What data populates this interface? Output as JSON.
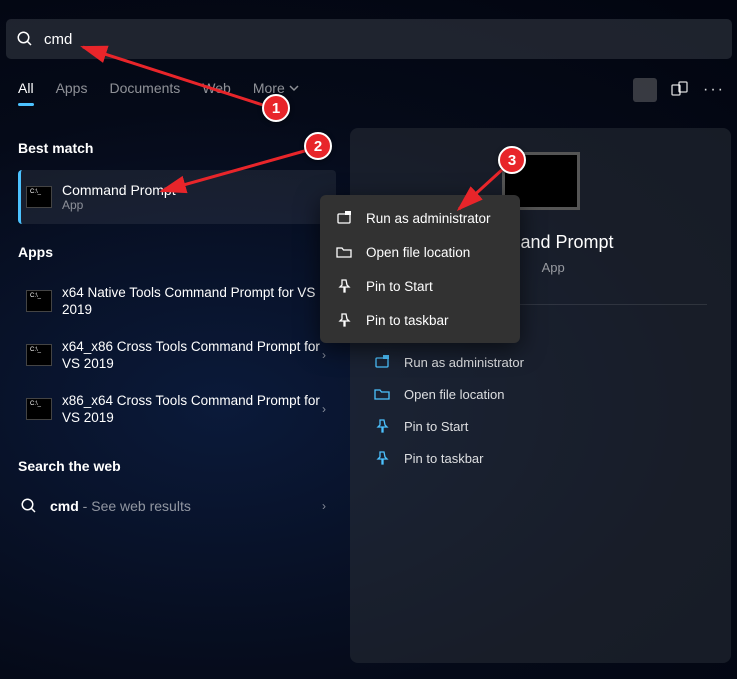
{
  "search": {
    "query": "cmd"
  },
  "tabs": {
    "items": [
      "All",
      "Apps",
      "Documents",
      "Web",
      "More"
    ],
    "active_index": 0
  },
  "sections": {
    "best_match": {
      "header": "Best match",
      "item": {
        "title": "Command Prompt",
        "subtitle": "App",
        "icon_text": "C:\\_"
      }
    },
    "apps": {
      "header": "Apps",
      "items": [
        {
          "title": "x64 Native Tools Command Prompt for VS 2019",
          "icon_text": "C:\\_"
        },
        {
          "title": "x64_x86 Cross Tools Command Prompt for VS 2019",
          "icon_text": "C:\\_"
        },
        {
          "title": "x86_x64 Cross Tools Command Prompt for VS 2019",
          "icon_text": "C:\\_"
        }
      ]
    },
    "web": {
      "header": "Search the web",
      "query": "cmd",
      "suffix": " - See web results"
    }
  },
  "context_menu": {
    "items": [
      {
        "label": "Run as administrator",
        "icon": "shield"
      },
      {
        "label": "Open file location",
        "icon": "folder"
      },
      {
        "label": "Pin to Start",
        "icon": "pin"
      },
      {
        "label": "Pin to taskbar",
        "icon": "pin"
      }
    ]
  },
  "detail": {
    "title": "Command Prompt",
    "subtitle": "App",
    "title_visible_suffix": "and Prompt",
    "actions": [
      {
        "label": "Run as administrator",
        "icon": "shield"
      },
      {
        "label": "Open file location",
        "icon": "folder"
      },
      {
        "label": "Pin to Start",
        "icon": "pin"
      },
      {
        "label": "Pin to taskbar",
        "icon": "pin"
      }
    ]
  },
  "annotations": {
    "n1": "1",
    "n2": "2",
    "n3": "3"
  }
}
